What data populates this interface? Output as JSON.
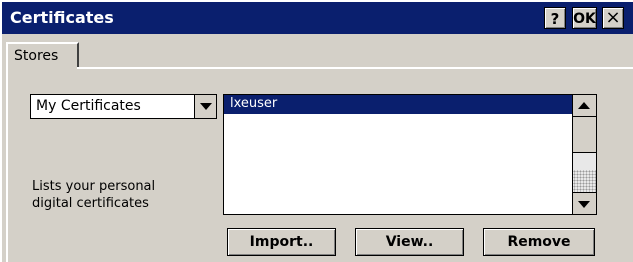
{
  "window": {
    "title": "Certificates",
    "help_label": "?",
    "ok_label": "OK",
    "close_label": "×"
  },
  "tabs": [
    {
      "label": "Stores"
    }
  ],
  "store_select": {
    "selected": "My Certificates"
  },
  "description": {
    "line1": "Lists your personal",
    "line2": "digital certificates"
  },
  "cert_list": {
    "items": [
      {
        "label": "lxeuser",
        "selected": true
      }
    ]
  },
  "buttons": {
    "import": "Import..",
    "view": "View..",
    "remove": "Remove"
  },
  "colors": {
    "titlebar": "#0a1f6e",
    "face": "#d4d0c8",
    "selection": "#0a1f6e"
  }
}
